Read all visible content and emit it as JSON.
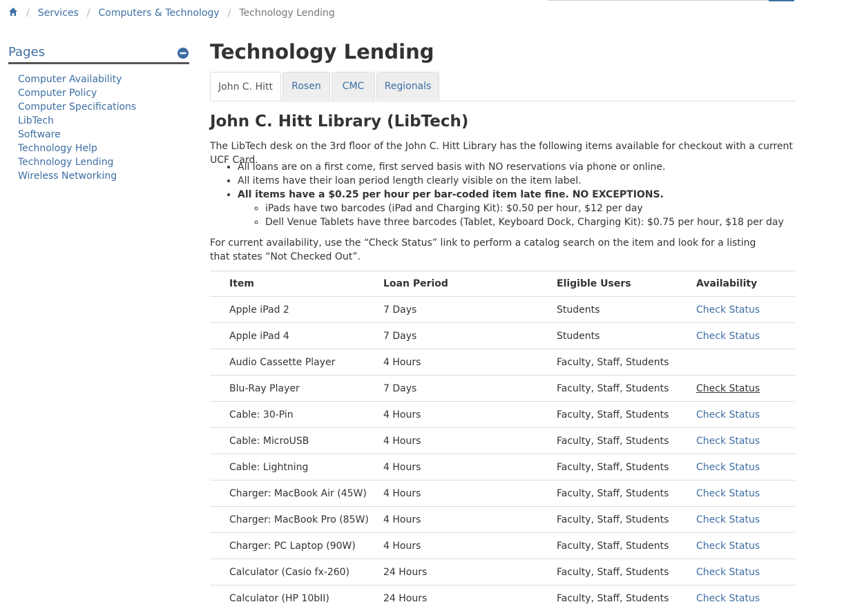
{
  "breadcrumb": {
    "home_icon": "home-icon",
    "items": [
      "Services",
      "Computers & Technology"
    ],
    "current": "Technology Lending"
  },
  "sidebar": {
    "title": "Pages",
    "collapse_icon": "minus-circle-icon",
    "items": [
      "Computer Availability",
      "Computer Policy",
      "Computer Specifications",
      "LibTech",
      "Software",
      "Technology Help",
      "Technology Lending",
      "Wireless Networking"
    ]
  },
  "main": {
    "title": "Technology Lending",
    "tabs": [
      {
        "label": "John C. Hitt",
        "active": true
      },
      {
        "label": "Rosen",
        "active": false
      },
      {
        "label": "CMC",
        "active": false
      },
      {
        "label": "Regionals",
        "active": false
      }
    ],
    "section_title": "John C. Hitt Library (LibTech)",
    "intro": "The LibTech desk on the 3rd floor of the John C. Hitt Library has the following items available for checkout with a current UCF Card.",
    "bullets": [
      "All loans are on a first come, first served basis with NO reservations via phone or online.",
      "All items have their loan period length clearly visible on the item label.",
      "All items have a $0.25 per hour per bar-coded item late fine. NO EXCEPTIONS."
    ],
    "sub_bullets": [
      "iPads have two barcodes (iPad and Charging Kit): $0.50 per hour, $12 per day",
      "Dell Venue Tablets have three barcodes (Tablet, Keyboard Dock, Charging Kit): $0.75 per hour, $18 per day"
    ],
    "availability_note": "For current availability, use the “Check Status” link to perform a catalog search on the item and look for a listing that states “Not Checked Out”."
  },
  "table": {
    "headers": [
      "Item",
      "Loan Period",
      "Eligible Users",
      "Availability"
    ],
    "rows": [
      {
        "item": "Apple iPad 2",
        "loan": "7 Days",
        "users": "Students",
        "availability": "Check Status"
      },
      {
        "item": "Apple iPad 4",
        "loan": "7 Days",
        "users": "Students",
        "availability": "Check Status"
      },
      {
        "item": "Audio Cassette Player",
        "loan": "4 Hours",
        "users": "Faculty, Staff, Students",
        "availability": ""
      },
      {
        "item": "Blu-Ray Player",
        "loan": "7 Days",
        "users": "Faculty, Staff, Students",
        "availability": "Check Status",
        "hover": true
      },
      {
        "item": "Cable: 30-Pin",
        "loan": "4 Hours",
        "users": "Faculty, Staff, Students",
        "availability": "Check Status"
      },
      {
        "item": "Cable: MicroUSB",
        "loan": "4 Hours",
        "users": "Faculty, Staff, Students",
        "availability": "Check Status"
      },
      {
        "item": "Cable: Lightning",
        "loan": "4 Hours",
        "users": "Faculty, Staff, Students",
        "availability": "Check Status"
      },
      {
        "item": "Charger: MacBook Air (45W)",
        "loan": "4 Hours",
        "users": "Faculty, Staff, Students",
        "availability": "Check Status"
      },
      {
        "item": "Charger: MacBook Pro (85W)",
        "loan": "4 Hours",
        "users": "Faculty, Staff, Students",
        "availability": "Check Status"
      },
      {
        "item": "Charger: PC Laptop (90W)",
        "loan": "4 Hours",
        "users": "Faculty, Staff, Students",
        "availability": "Check Status"
      },
      {
        "item": "Calculator (Casio fx-260)",
        "loan": "24 Hours",
        "users": "Faculty, Staff, Students",
        "availability": "Check Status"
      },
      {
        "item": "Calculator (HP 10bII)",
        "loan": "24 Hours",
        "users": "Faculty, Staff, Students",
        "availability": "Check Status"
      }
    ]
  },
  "colors": {
    "link": "#3d6ea3",
    "text": "#333333",
    "border": "#dddddd",
    "tab_bg": "#eeeeee"
  }
}
